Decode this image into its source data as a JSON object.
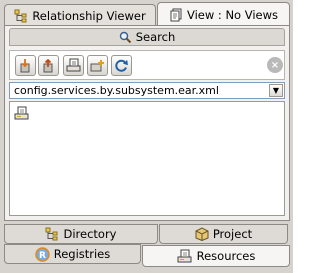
{
  "tabs_top": {
    "relationship_viewer": {
      "label": "Relationship Viewer",
      "icon": "relationship-tree-icon"
    },
    "view": {
      "label": "View : No Views",
      "icon": "view-pages-icon"
    }
  },
  "search_tab": {
    "label": "Search",
    "icon": "magnifier-icon"
  },
  "toolbar": {
    "buttons": [
      "import-icon",
      "export-icon",
      "deploy-icon",
      "new-folder-icon",
      "refresh-icon"
    ],
    "stop_button": "stop-icon"
  },
  "file_select": {
    "value": "config.services.by.subsystem.ear.xml"
  },
  "list": {
    "items": [
      {
        "icon": "server-icon"
      }
    ]
  },
  "tabs_bottom": {
    "directory": {
      "label": "Directory",
      "icon": "directory-icon"
    },
    "project": {
      "label": "Project",
      "icon": "project-box-icon"
    },
    "registries": {
      "label": "Registries",
      "icon": "registry-r-icon"
    },
    "resources": {
      "label": "Resources",
      "icon": "resources-icon"
    }
  },
  "colors": {
    "accent_blue": "#1f5fa8",
    "accent_orange": "#d9731a",
    "background": "#d6d3ce"
  }
}
